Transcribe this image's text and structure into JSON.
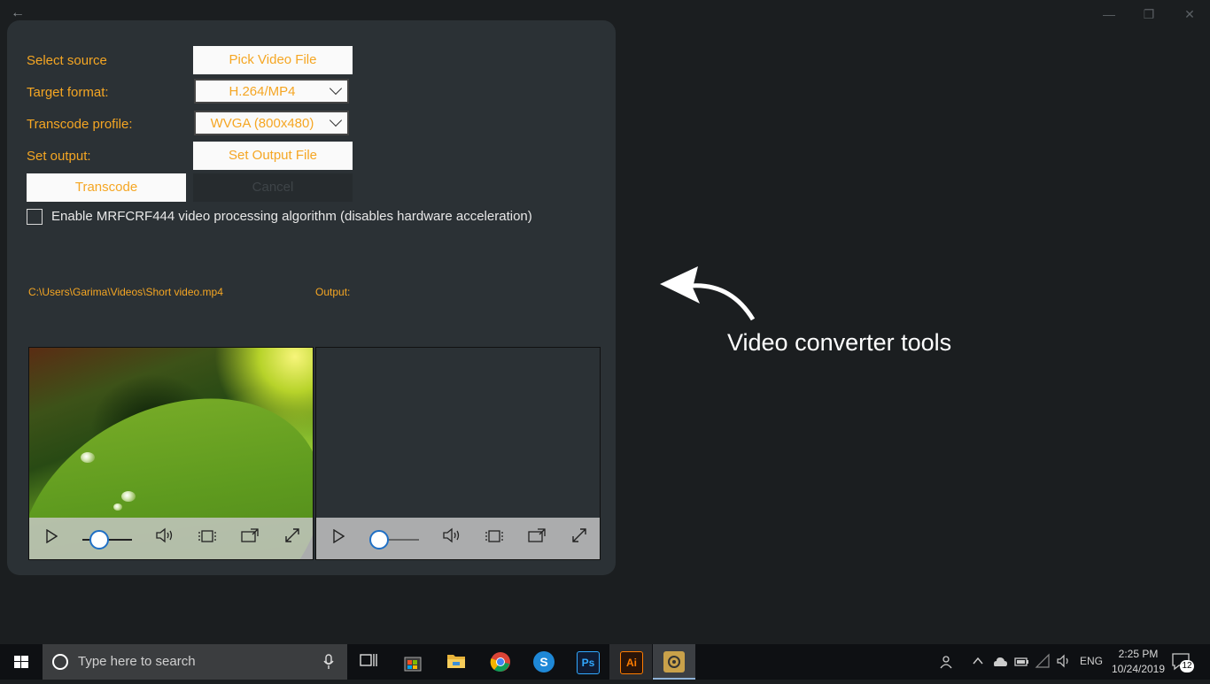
{
  "window": {
    "back_glyph": "←",
    "minimize_glyph": "—",
    "restore_glyph": "❐",
    "close_glyph": "✕"
  },
  "form": {
    "select_source_label": "Select source",
    "pick_video_button": "Pick Video File",
    "target_format_label": "Target format:",
    "target_format_value": "H.264/MP4",
    "transcode_profile_label": "Transcode profile:",
    "transcode_profile_value": "WVGA (800x480)",
    "set_output_label": "Set output:",
    "set_output_button": "Set Output File",
    "transcode_button": "Transcode",
    "cancel_button": "Cancel",
    "mrf_checkbox_label": "Enable MRFCRF444 video processing algorithm (disables hardware acceleration)",
    "mrf_checked": false
  },
  "paths": {
    "input_path": "C:\\Users\\Garima\\Videos\\Short video.mp4",
    "output_label": "Output:"
  },
  "players": [
    {
      "name": "source-player",
      "position_fraction": 0.3
    },
    {
      "name": "output-player",
      "position_fraction": 0.0
    }
  ],
  "annotation": {
    "text": "Video converter tools"
  },
  "taskbar": {
    "search_placeholder": "Type here to search",
    "language": "ENG",
    "time": "2:25 PM",
    "date": "10/24/2019",
    "notification_count": "12",
    "apps": [
      "task-view",
      "microsoft-store",
      "file-explorer",
      "chrome",
      "skype",
      "photoshop",
      "illustrator",
      "transcode-app"
    ]
  },
  "colors": {
    "accent_text": "#f5a623",
    "panel_bg": "#2b3135",
    "page_bg": "#1b1e20",
    "progress_knob": "#1f6fc5"
  }
}
